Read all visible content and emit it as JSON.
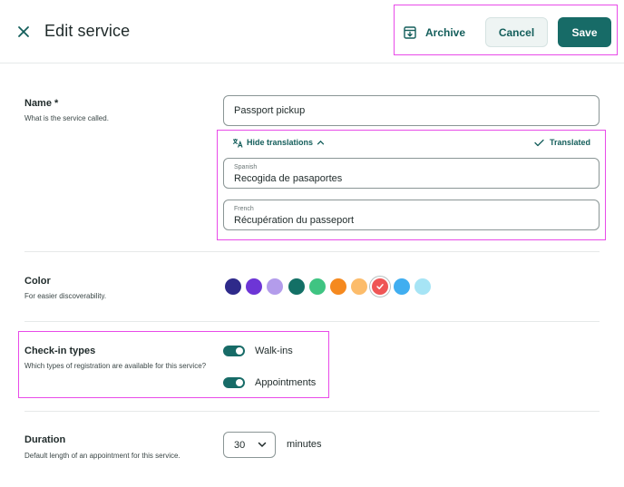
{
  "header": {
    "title": "Edit service",
    "close_icon": "close-icon",
    "archive_label": "Archive",
    "archive_icon": "archive-box-icon",
    "cancel_label": "Cancel",
    "save_label": "Save"
  },
  "name_section": {
    "label": "Name *",
    "help": "What is the service called.",
    "value": "Passport pickup",
    "hide_translations_label": "Hide translations",
    "translate_icon": "translate-icon",
    "translated_label": "Translated",
    "translations": [
      {
        "language": "Spanish",
        "value": "Recogida de pasaportes"
      },
      {
        "language": "French",
        "value": "Récupération du passeport"
      }
    ]
  },
  "color_section": {
    "label": "Color",
    "help": "For easier discoverability.",
    "swatches": [
      "#2e2a8a",
      "#6d35d6",
      "#b39ceb",
      "#137066",
      "#3fc482",
      "#f5891f",
      "#fcbc6b",
      "#ef5656",
      "#40aef0",
      "#a6e4f5"
    ],
    "selected_index": 7
  },
  "checkin_section": {
    "label": "Check-in types",
    "help": "Which types of registration are available for this service?",
    "options": [
      {
        "label": "Walk-ins",
        "enabled": true
      },
      {
        "label": "Appointments",
        "enabled": true
      }
    ]
  },
  "duration_section": {
    "label": "Duration",
    "help": "Default length of an appointment for this service.",
    "value": "30",
    "unit": "minutes"
  },
  "colors": {
    "accent": "#176b67",
    "highlight": "#e84be8"
  }
}
